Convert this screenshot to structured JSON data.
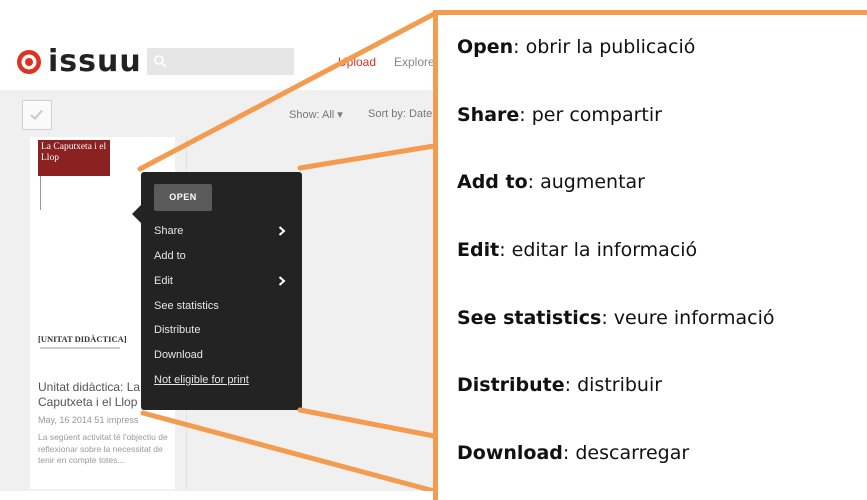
{
  "header": {
    "logo_text": "issuu",
    "search_placeholder": "",
    "nav_upload": "Upload",
    "nav_explore": "Explore"
  },
  "toolbar": {
    "show_all": "Show: All ▾",
    "sort_by": "Sort by: Date"
  },
  "publication": {
    "cover_title": "La Caputxeta i el Llop",
    "cover_subtitle": "[UNITAT DIDÀCTICA]",
    "title": "Unitat didàctica: La Caputxeta i el Llop",
    "meta": "May, 16 2014 51 impressions",
    "description": "La següent activitat té l'objectiu de reflexionar sobre la necessitat de tenir en compte totes..."
  },
  "menu": {
    "open_label": "OPEN",
    "items": [
      {
        "label": "Share",
        "has_submenu": true
      },
      {
        "label": "Add to",
        "has_submenu": false
      },
      {
        "label": "Edit",
        "has_submenu": true
      },
      {
        "label": "See statistics",
        "has_submenu": false
      },
      {
        "label": "Distribute",
        "has_submenu": false
      },
      {
        "label": "Download",
        "has_submenu": false
      }
    ],
    "print_link": "Not eligible for print"
  },
  "annotations": [
    {
      "term": "Open",
      "desc": ": obrir la publicació"
    },
    {
      "term": "Share",
      "desc": ": per compartir"
    },
    {
      "term": "Add to",
      "desc": ": augmentar"
    },
    {
      "term": "Edit",
      "desc": ": editar la informació"
    },
    {
      "term": "See statistics",
      "desc": ": veure informació"
    },
    {
      "term": "Distribute",
      "desc": ": distribuir"
    },
    {
      "term": "Download",
      "desc": ": descarregar"
    }
  ],
  "colors": {
    "callout_orange": "#f39b4e",
    "menu_bg": "#232323",
    "brand_red": "#e0301e",
    "cover_red": "#8b2121"
  }
}
